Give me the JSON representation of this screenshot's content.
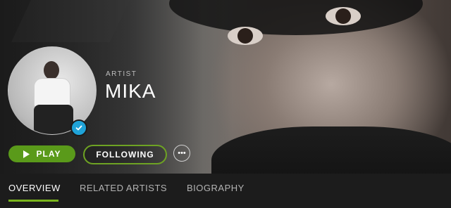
{
  "artist": {
    "kicker": "ARTIST",
    "name": "MIKA",
    "verified_icon": "check-icon"
  },
  "actions": {
    "play_label": "PLAY",
    "play_icon": "play-icon",
    "following_label": "FOLLOWING",
    "more_icon": "ellipsis-icon",
    "more_glyph": "•••"
  },
  "tabs": [
    {
      "label": "OVERVIEW",
      "active": true
    },
    {
      "label": "RELATED ARTISTS",
      "active": false
    },
    {
      "label": "BIOGRAPHY",
      "active": false
    }
  ],
  "colors": {
    "accent_green": "#5a9a1a",
    "follow_border": "#6ea323",
    "tab_underline": "#7ab51d",
    "verified_blue": "#1fa3d8",
    "background": "#181818"
  }
}
